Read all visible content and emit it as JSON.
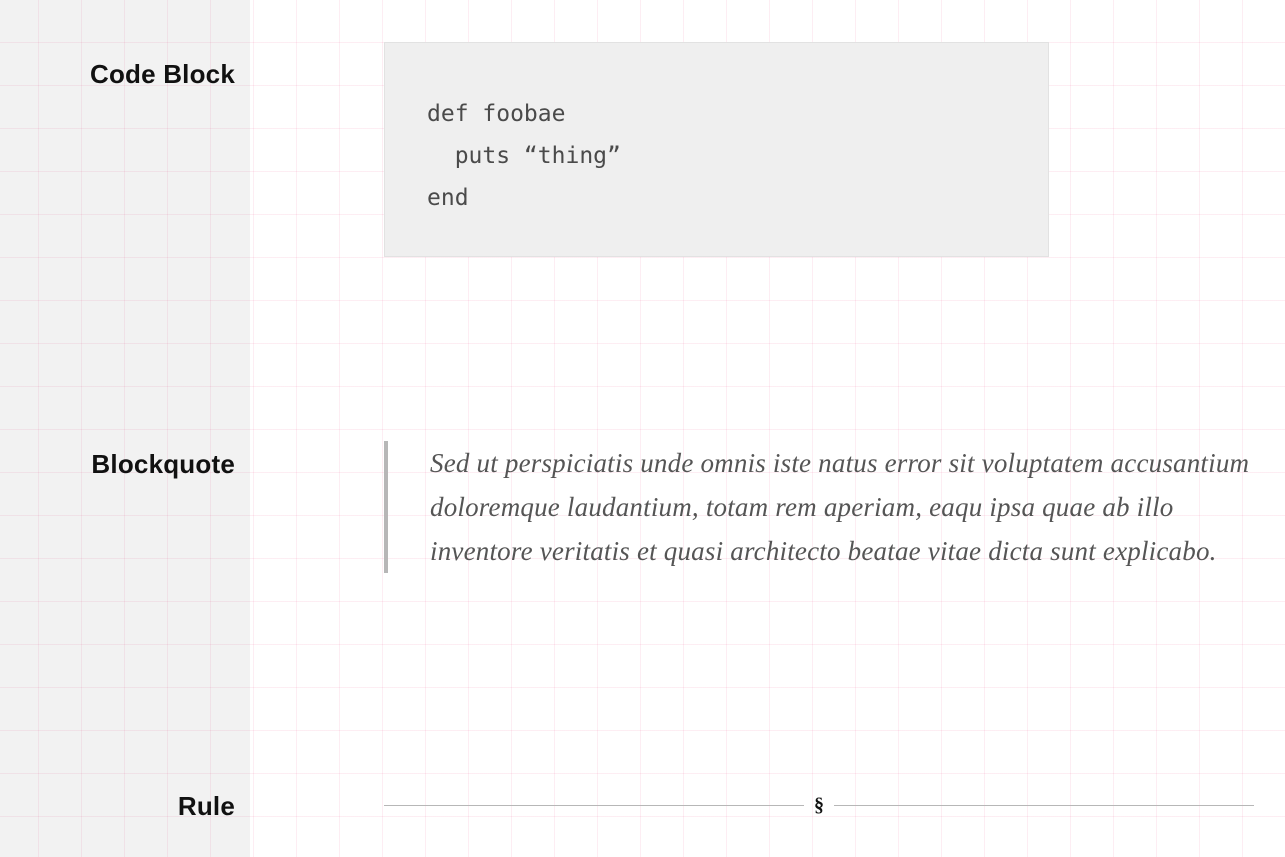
{
  "labels": {
    "code_block": "Code Block",
    "blockquote": "Blockquote",
    "rule": "Rule"
  },
  "code_block": {
    "content": "def foobae\n  puts “thing”\nend"
  },
  "blockquote": {
    "text": "Sed ut perspiciatis unde omnis iste natus error sit voluptatem accusantium doloremque laudantium, totam rem aperiam, eaqu ipsa quae ab illo inventore veritatis et quasi architecto beatae vitae dicta sunt explicabo."
  },
  "rule": {
    "ornament": "§"
  }
}
